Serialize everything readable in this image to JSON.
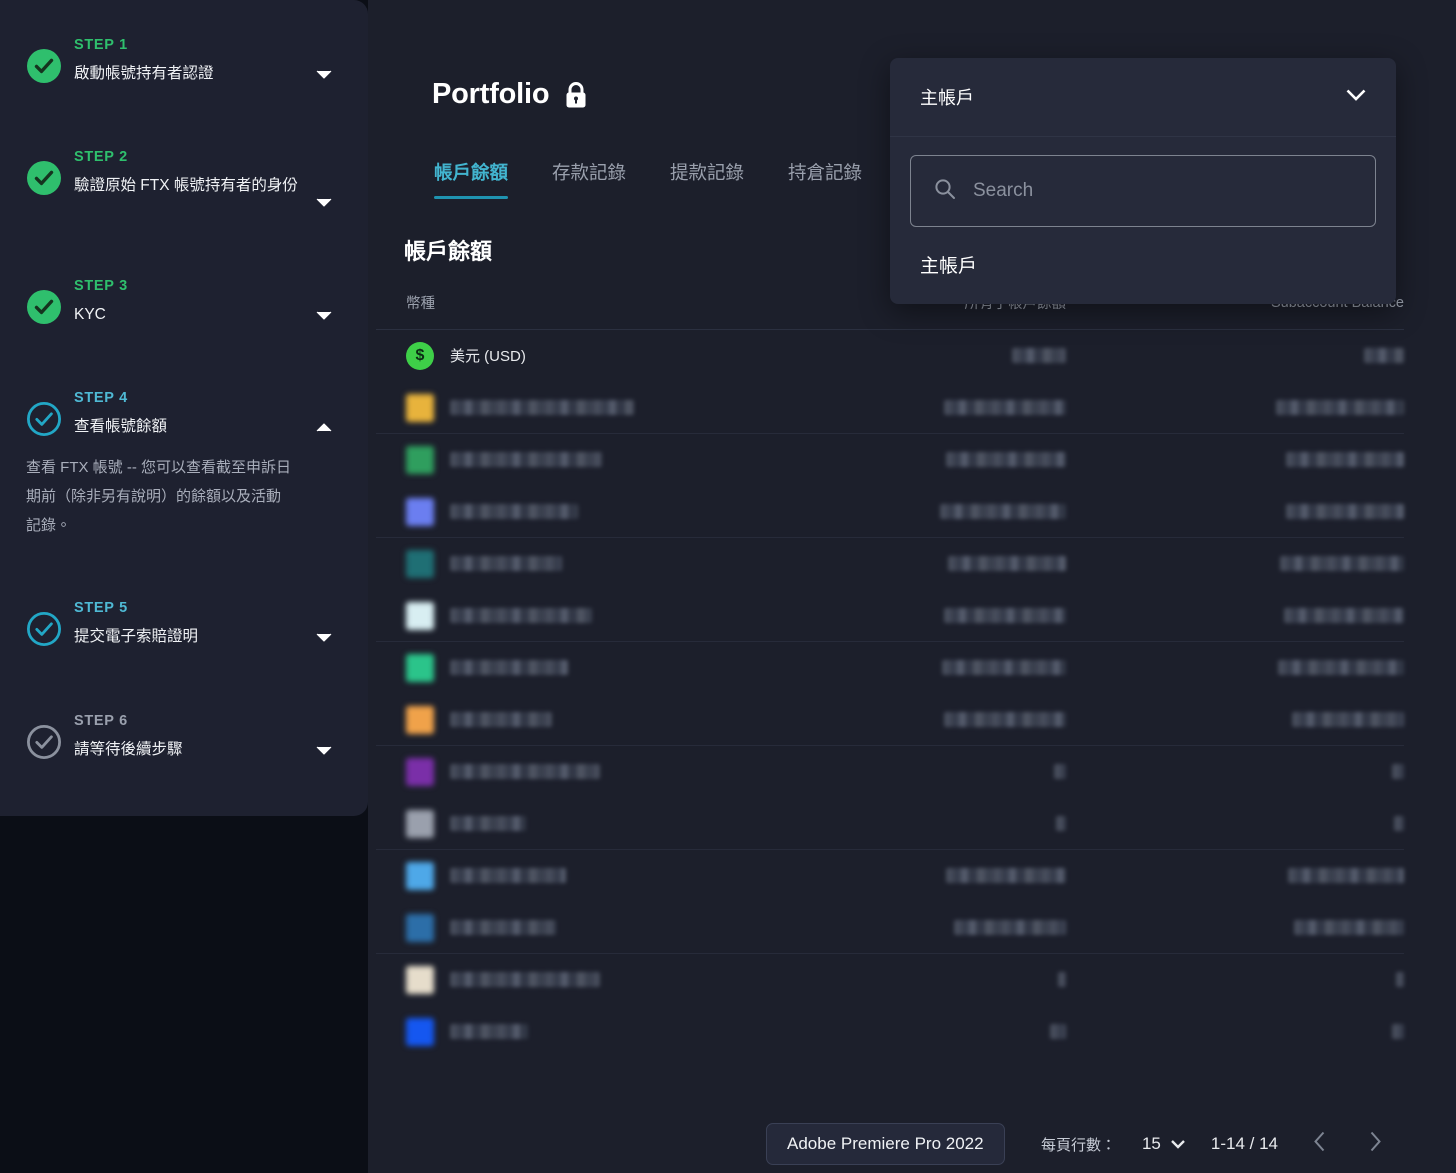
{
  "sidebar": {
    "steps": [
      {
        "kicker": "STEP 1",
        "title": "啟動帳號持有者認證",
        "state": "done",
        "expanded": false,
        "chevron": "chevron-down-icon",
        "body": null
      },
      {
        "kicker": "STEP 2",
        "title": "驗證原始 FTX 帳號持有者的身份",
        "state": "done",
        "expanded": false,
        "chevron": "chevron-down-icon",
        "body": null
      },
      {
        "kicker": "STEP 3",
        "title": "KYC",
        "state": "done",
        "expanded": false,
        "chevron": "chevron-down-icon",
        "body": null
      },
      {
        "kicker": "STEP 4",
        "title": "查看帳號餘額",
        "state": "active",
        "expanded": true,
        "chevron": "chevron-up-icon",
        "body": "查看 FTX 帳號 -- 您可以查看截至申訴日期前（除非另有說明）的餘額以及活動記錄。"
      },
      {
        "kicker": "STEP 5",
        "title": "提交電子索賠證明",
        "state": "active",
        "expanded": false,
        "chevron": "chevron-down-icon",
        "body": null
      },
      {
        "kicker": "STEP 6",
        "title": "請等待後續步驟",
        "state": "pending",
        "expanded": false,
        "chevron": "chevron-down-icon",
        "body": null
      }
    ]
  },
  "header": {
    "title": "Portfolio",
    "lock_icon": "lock-icon"
  },
  "tabs": [
    {
      "label": "帳戶餘額",
      "active": true
    },
    {
      "label": "存款記錄",
      "active": false
    },
    {
      "label": "提款記錄",
      "active": false
    },
    {
      "label": "持倉記錄",
      "active": false
    }
  ],
  "section": {
    "title": "帳戶餘額"
  },
  "table": {
    "columns": {
      "asset": "幣種",
      "all_subaccounts": "所有子帳戶餘額",
      "subaccount": "Subaccount Balance"
    },
    "rows": [
      {
        "asset": "美元 (USD)",
        "redacted": false,
        "coin_color": "#3ecf48",
        "coin_glyph": "$",
        "all_subaccounts": "",
        "subaccount": "",
        "all_w": 54,
        "sub_w": 40,
        "name_w": 0,
        "sep_after": false
      },
      {
        "asset": "",
        "redacted": true,
        "coin_color": "#e8b33c",
        "coin_glyph": "",
        "all_subaccounts": "",
        "subaccount": "",
        "all_w": 122,
        "sub_w": 128,
        "name_w": 184,
        "sep_after": true
      },
      {
        "asset": "",
        "redacted": true,
        "coin_color": "#2f9e5e",
        "coin_glyph": "",
        "all_subaccounts": "",
        "subaccount": "",
        "all_w": 120,
        "sub_w": 118,
        "name_w": 152,
        "sep_after": false
      },
      {
        "asset": "",
        "redacted": true,
        "coin_color": "#6b7ef0",
        "coin_glyph": "",
        "all_subaccounts": "",
        "subaccount": "",
        "all_w": 126,
        "sub_w": 118,
        "name_w": 128,
        "sep_after": true
      },
      {
        "asset": "",
        "redacted": true,
        "coin_color": "#1f6f74",
        "coin_glyph": "",
        "all_subaccounts": "",
        "subaccount": "",
        "all_w": 118,
        "sub_w": 124,
        "name_w": 112,
        "sep_after": false
      },
      {
        "asset": "",
        "redacted": true,
        "coin_color": "#d8eef2",
        "coin_glyph": "",
        "all_subaccounts": "",
        "subaccount": "",
        "all_w": 122,
        "sub_w": 120,
        "name_w": 142,
        "sep_after": true
      },
      {
        "asset": "",
        "redacted": true,
        "coin_color": "#2bc48a",
        "coin_glyph": "",
        "all_subaccounts": "",
        "subaccount": "",
        "all_w": 124,
        "sub_w": 126,
        "name_w": 118,
        "sep_after": false
      },
      {
        "asset": "",
        "redacted": true,
        "coin_color": "#f0a24a",
        "coin_glyph": "",
        "all_subaccounts": "",
        "subaccount": "",
        "all_w": 122,
        "sub_w": 112,
        "name_w": 102,
        "sep_after": true
      },
      {
        "asset": "",
        "redacted": true,
        "coin_color": "#7a2fa8",
        "coin_glyph": "",
        "all_subaccounts": "",
        "subaccount": "",
        "all_w": 12,
        "sub_w": 12,
        "name_w": 150,
        "sep_after": false
      },
      {
        "asset": "",
        "redacted": true,
        "coin_color": "#9aa0ad",
        "coin_glyph": "",
        "all_subaccounts": "",
        "subaccount": "",
        "all_w": 10,
        "sub_w": 10,
        "name_w": 76,
        "sep_after": true
      },
      {
        "asset": "",
        "redacted": true,
        "coin_color": "#4ea8e8",
        "coin_glyph": "",
        "all_subaccounts": "",
        "subaccount": "",
        "all_w": 120,
        "sub_w": 116,
        "name_w": 116,
        "sep_after": false
      },
      {
        "asset": "",
        "redacted": true,
        "coin_color": "#2c6ea8",
        "coin_glyph": "",
        "all_subaccounts": "",
        "subaccount": "",
        "all_w": 112,
        "sub_w": 110,
        "name_w": 106,
        "sep_after": true
      },
      {
        "asset": "",
        "redacted": true,
        "coin_color": "#e6ddcb",
        "coin_glyph": "",
        "all_subaccounts": "",
        "subaccount": "",
        "all_w": 8,
        "sub_w": 8,
        "name_w": 150,
        "sep_after": false
      },
      {
        "asset": "",
        "redacted": true,
        "coin_color": "#1557f0",
        "coin_glyph": "",
        "all_subaccounts": "",
        "subaccount": "",
        "all_w": 16,
        "sub_w": 12,
        "name_w": 78,
        "sep_after": false
      }
    ]
  },
  "subaccount_dropdown": {
    "selected": "主帳戶",
    "chevron": "chevron-down-icon",
    "search": {
      "placeholder": "Search",
      "value": "",
      "icon": "search-icon"
    },
    "options": [
      "主帳戶"
    ]
  },
  "pagination": {
    "rows_per_page_label": "每頁行數：",
    "rows_per_page_value": "15",
    "range": "1-14 / 14",
    "prev_icon": "chevron-left-icon",
    "next_icon": "chevron-right-icon"
  },
  "os_tooltip": {
    "text": "Adobe Premiere Pro 2022"
  },
  "colors": {
    "accent_cyan": "#42b4cf",
    "accent_cyan_underline": "#1f93b0",
    "success_green": "#2fbf6d",
    "pending_gray": "#9aa0ad",
    "page_bg": "#0b0e16",
    "sidebar_bg": "#1e2130",
    "main_bg": "#1c1f2b",
    "dropdown_bg": "#262a3a"
  }
}
